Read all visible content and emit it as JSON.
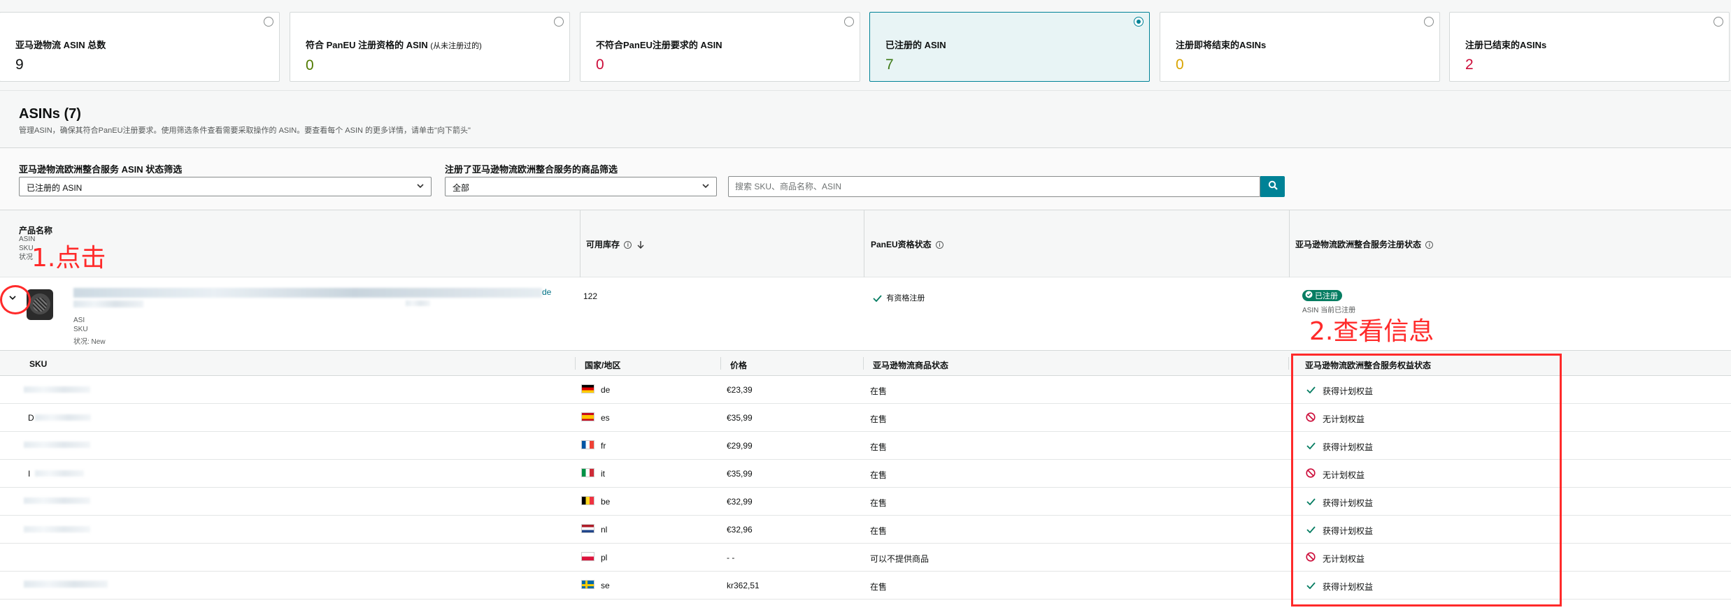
{
  "cards": [
    {
      "label": "亚马逊物流 ASIN 总数",
      "note": "",
      "value": "9",
      "color": "#0f1111",
      "selected": false
    },
    {
      "label": "符合 PanEU 注册资格的 ASIN",
      "note": "(从未注册过的)",
      "value": "0",
      "color": "#507a00",
      "selected": false
    },
    {
      "label": "不符合PanEU注册要求的 ASIN",
      "note": "",
      "value": "0",
      "color": "#cc0c39",
      "selected": false
    },
    {
      "label": "已注册的 ASIN",
      "note": "",
      "value": "7",
      "color": "#3e7a18",
      "selected": true
    },
    {
      "label": "注册即将结束的ASINs",
      "note": "",
      "value": "0",
      "color": "#d9a400",
      "selected": false
    },
    {
      "label": "注册已结束的ASINs",
      "note": "",
      "value": "2",
      "color": "#cc0c39",
      "selected": false
    }
  ],
  "asins": {
    "title": "ASINs (7)",
    "description": "管理ASIN，确保其符合PanEU注册要求。使用筛选条件查看需要采取操作的 ASIN。要查看每个 ASIN 的更多详情，请单击\"向下箭头\""
  },
  "filters": {
    "status_label": "亚马逊物流欧洲整合服务 ASIN 状态筛选",
    "status_value": "已注册的 ASIN",
    "product_label": "注册了亚马逊物流欧洲整合服务的商品筛选",
    "product_value": "全部",
    "search_placeholder": "搜索 SKU、商品名称、ASIN"
  },
  "table": {
    "col_product": "产品名称",
    "col_product_sub": [
      "ASIN",
      "SKU",
      "状况"
    ],
    "col_stock": "可用库存",
    "col_paneu": "PanEU资格状态",
    "col_enrollment": "亚马逊物流欧洲整合服务注册状态"
  },
  "product": {
    "title_suffix": "de",
    "sub_asin": "ASI",
    "sub_sku": "SKU",
    "condition": "状况: New",
    "stock": "122",
    "paneu_status": "有资格注册",
    "enrollment_badge": "已注册",
    "enrollment_note": "ASIN 当前已注册"
  },
  "sub_table": {
    "col_sku": "SKU",
    "col_country": "国家/地区",
    "col_price": "价格",
    "col_listing": "亚马逊物流商品状态",
    "col_benefit": "亚马逊物流欧洲整合服务权益状态",
    "rows": [
      {
        "sku": "",
        "country": "de",
        "price": "€23,39",
        "listing": "在售",
        "benefit": "获得计划权益",
        "eligible": true
      },
      {
        "sku": "D",
        "country": "es",
        "price": "€35,99",
        "listing": "在售",
        "benefit": "无计划权益",
        "eligible": false
      },
      {
        "sku": "",
        "country": "fr",
        "price": "€29,99",
        "listing": "在售",
        "benefit": "获得计划权益",
        "eligible": true
      },
      {
        "sku": "I",
        "country": "it",
        "price": "€35,99",
        "listing": "在售",
        "benefit": "无计划权益",
        "eligible": false
      },
      {
        "sku": "",
        "country": "be",
        "price": "€32,99",
        "listing": "在售",
        "benefit": "获得计划权益",
        "eligible": true
      },
      {
        "sku": "",
        "country": "nl",
        "price": "€32,96",
        "listing": "在售",
        "benefit": "获得计划权益",
        "eligible": true
      },
      {
        "sku": "",
        "country": "pl",
        "price": "- -",
        "listing": "可以不提供商品",
        "benefit": "无计划权益",
        "eligible": false
      },
      {
        "sku": "",
        "country": "se",
        "price": "kr362,51",
        "listing": "在售",
        "benefit": "获得计划权益",
        "eligible": true
      }
    ]
  },
  "annotations": {
    "step1": "1.点击",
    "step2": "2.查看信息",
    "color": "#ff2a2a"
  }
}
